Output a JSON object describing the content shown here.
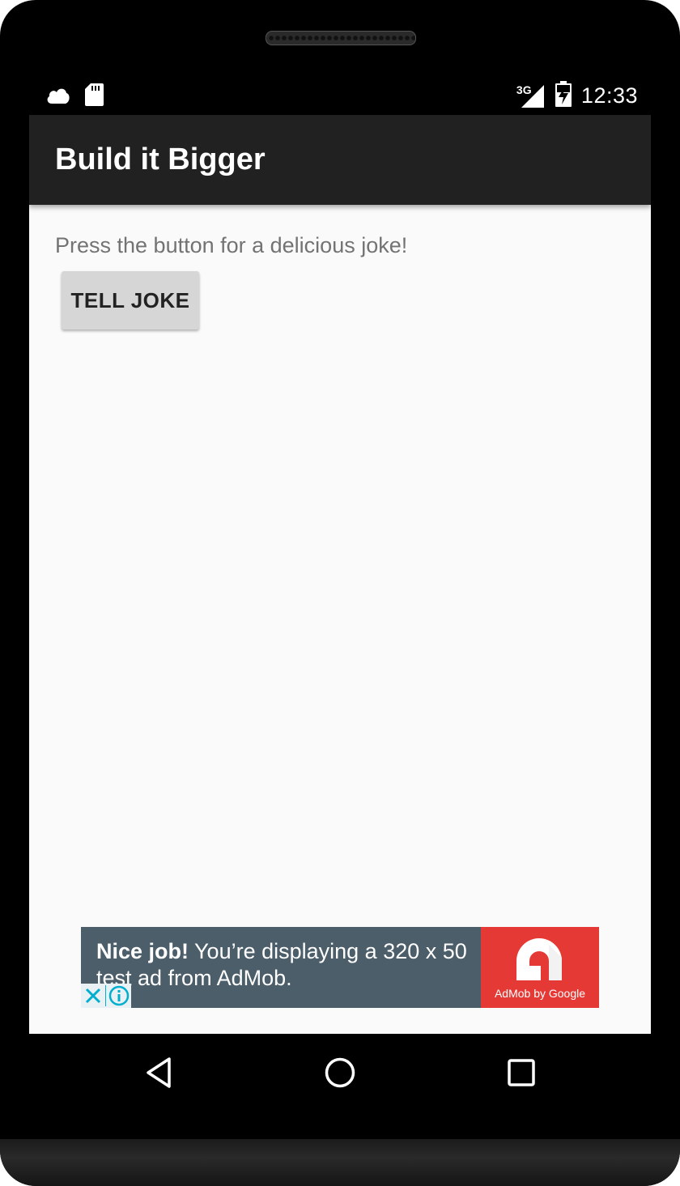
{
  "status_bar": {
    "time": "12:33",
    "network": "3G",
    "icons": [
      "cloud-icon",
      "sd-card-icon",
      "signal-icon",
      "battery-charging-icon"
    ]
  },
  "toolbar": {
    "title": "Build it Bigger"
  },
  "main": {
    "instructions": "Press the button for a delicious joke!",
    "tell_joke_label": "TELL JOKE"
  },
  "ad": {
    "headline": "Nice job!",
    "body": "You’re displaying a 320 x 50 test ad from AdMob.",
    "brand": "AdMob by Google"
  },
  "nav_bar": {
    "icons": [
      "back-icon",
      "home-icon",
      "recents-icon"
    ]
  },
  "colors": {
    "toolbar": "#212121",
    "background": "#fafafa",
    "button": "#d6d6d7",
    "ad_background": "#4b5e6a",
    "ad_logo": "#e53935"
  }
}
